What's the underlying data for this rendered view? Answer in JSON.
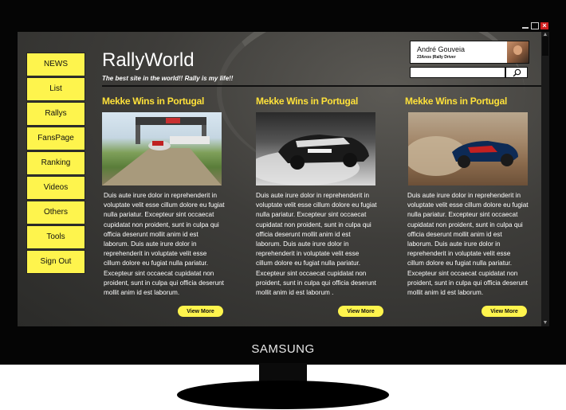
{
  "brand": "SAMSUNG",
  "site": {
    "title": "RallyWorld",
    "tagline": "The best site in the world!! Rally is my life!!"
  },
  "nav": [
    "NEWS",
    "List",
    "Rallys",
    "FansPage",
    "Ranking",
    "Videos",
    "Others",
    "Tools",
    "Sign Out"
  ],
  "profile": {
    "name": "André Gouveia",
    "role": "23Anos |Rally Driver"
  },
  "search": {
    "placeholder": ""
  },
  "articles": [
    {
      "title": "Mekke Wins in Portugal",
      "body": "Duis aute irure dolor in reprehenderit in voluptate velit esse cillum dolore eu fugiat nulla pariatur. Excepteur sint occaecat cupidatat non proident, sunt in culpa qui officia deserunt mollit anim id est laborum. Duis aute irure dolor in reprehenderit in voluptate velit esse cillum dolore eu fugiat nulla pariatur. Excepteur sint occaecat cupidatat non proident, sunt in culpa qui officia deserunt mollit anim id est laborum.",
      "button": "View More"
    },
    {
      "title": "Mekke Wins in Portugal",
      "body": "Duis aute irure dolor in reprehenderit in voluptate velit esse cillum dolore eu fugiat nulla pariatur. Excepteur sint occaecat cupidatat non proident, sunt in culpa qui officia deserunt mollit anim id est laborum. Duis aute irure dolor in reprehenderit in voluptate velit esse cillum dolore eu fugiat nulla pariatur. Excepteur sint occaecat cupidatat non proident, sunt in culpa qui officia deserunt mollit anim id est laborum .",
      "button": "View More"
    },
    {
      "title": "Mekke Wins in Portugal",
      "body": "Duis aute irure dolor in reprehenderit in voluptate velit esse cillum dolore eu fugiat nulla pariatur. Excepteur sint occaecat cupidatat non proident, sunt in culpa qui officia deserunt mollit anim id est laborum. Duis aute irure dolor in reprehenderit in voluptate velit esse cillum dolore eu fugiat nulla pariatur. Excepteur sint occaecat cupidatat non proident, sunt in culpa qui officia deserunt mollit anim id est laborum.",
      "button": "View More"
    }
  ],
  "colors": {
    "accent": "#fef44d",
    "title": "#fde03a",
    "screen": "#3e3d3a",
    "bezel": "#050505"
  }
}
